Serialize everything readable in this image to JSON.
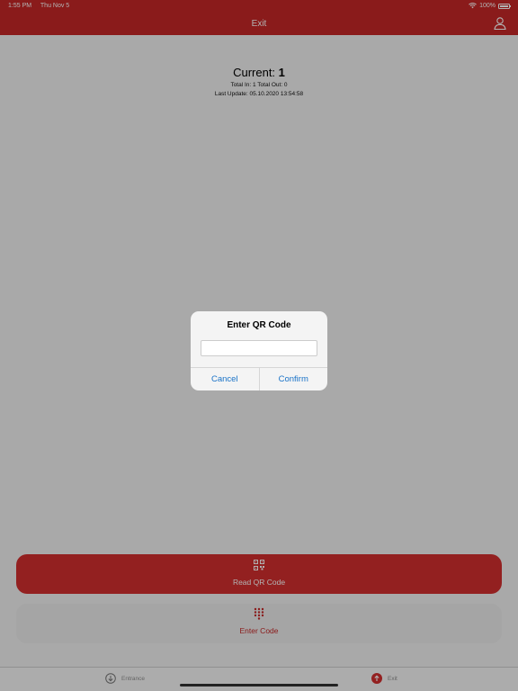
{
  "status_bar": {
    "time": "1:55 PM",
    "date": "Thu Nov 5",
    "battery": "100%"
  },
  "nav": {
    "title": "Exit",
    "icons": {
      "user": "user-icon"
    }
  },
  "counter": {
    "current_label": "Current:",
    "current_value": "1",
    "totals": "Total In: 1 Total Out: 0",
    "last_update": "Last Update: 05.10.2020 13:54:58"
  },
  "actions": {
    "read_qr": {
      "label": "Read QR Code",
      "icon": "qr-code-icon"
    },
    "enter_code": {
      "label": "Enter Code",
      "icon": "keypad-icon"
    }
  },
  "tabs": [
    {
      "label": "Entrance",
      "icon": "arrow-down-circle-icon",
      "active": false
    },
    {
      "label": "Exit",
      "icon": "arrow-up-circle-icon",
      "active": true
    }
  ],
  "dialog": {
    "title": "Enter QR Code",
    "input_value": "",
    "input_placeholder": "",
    "cancel_label": "Cancel",
    "confirm_label": "Confirm"
  },
  "colors": {
    "brand_red": "#c62828",
    "button_red": "#d32f2f",
    "link_blue": "#1a73c8"
  }
}
